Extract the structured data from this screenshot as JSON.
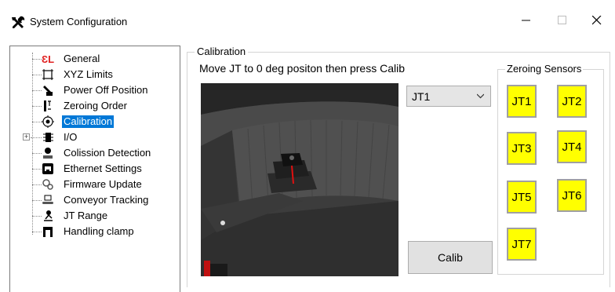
{
  "window": {
    "title": "System Configuration",
    "icon": "tools-icon",
    "minimize": "—",
    "maximize": "☐",
    "close": "✕"
  },
  "tree": {
    "items": [
      {
        "label": "General",
        "icon": "general-icon"
      },
      {
        "label": "XYZ Limits",
        "icon": "xyz-limits-icon"
      },
      {
        "label": "Power Off Position",
        "icon": "power-off-icon"
      },
      {
        "label": "Zeroing Order",
        "icon": "zeroing-order-icon"
      },
      {
        "label": "Calibration",
        "icon": "calibration-icon",
        "selected": true
      },
      {
        "label": "I/O",
        "icon": "io-icon",
        "expander": "+"
      },
      {
        "label": "Colission Detection",
        "icon": "collision-icon"
      },
      {
        "label": "Ethernet Settings",
        "icon": "ethernet-icon"
      },
      {
        "label": "Firmware Update",
        "icon": "firmware-icon"
      },
      {
        "label": "Conveyor Tracking",
        "icon": "conveyor-icon"
      },
      {
        "label": "JT Range",
        "icon": "jt-range-icon"
      },
      {
        "label": "Handling clamp",
        "icon": "clamp-icon"
      }
    ]
  },
  "calibration": {
    "group_label": "Calibration",
    "instruction": "Move JT to 0 deg positon then press Calib",
    "joint_select": {
      "value": "JT1"
    },
    "calib_button": "Calib"
  },
  "zeroing": {
    "group_label": "Zeroing Sensors",
    "sensors": [
      "JT1",
      "JT2",
      "JT3",
      "JT4",
      "JT5",
      "JT6",
      "JT7"
    ],
    "sensor_color": "#ffff00"
  }
}
